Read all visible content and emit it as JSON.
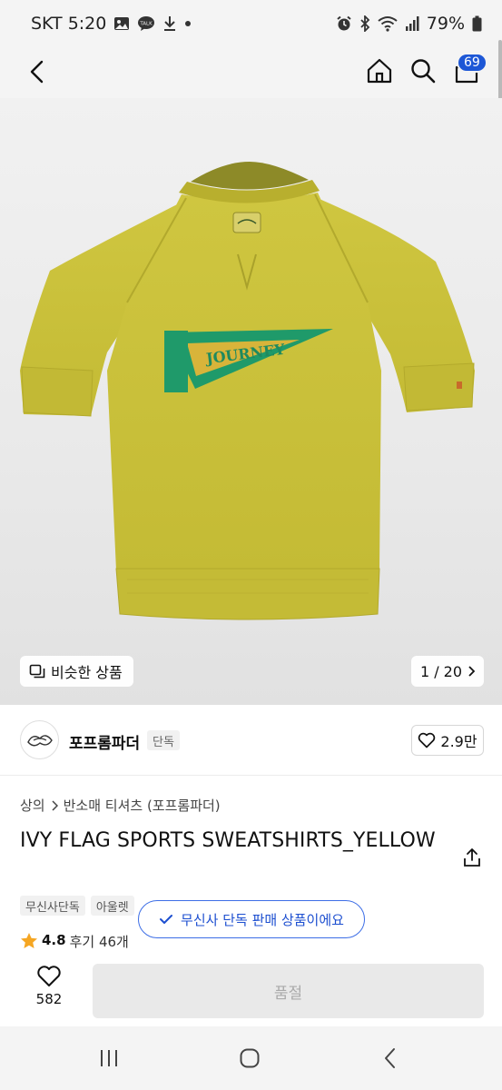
{
  "status_bar": {
    "carrier_time": "SKT 5:20",
    "battery": "79%",
    "left_icons": [
      "image-icon",
      "talk-icon",
      "download-icon",
      "dot-icon"
    ],
    "right_icons": [
      "alarm-icon",
      "bluetooth-icon",
      "wifi-icon",
      "signal-icon",
      "battery-icon"
    ]
  },
  "nav": {
    "cart_count": "69"
  },
  "gallery": {
    "similar_label": "비슷한 상품",
    "counter": "1 / 20",
    "print_text": "JOURNEY"
  },
  "brand": {
    "name": "포프롬파더",
    "tag": "단독",
    "likes": "2.9만"
  },
  "breadcrumb": {
    "category": "상의",
    "subcategory": "반소매 티셔츠 (포프롬파더)"
  },
  "product": {
    "title": "IVY FLAG SPORTS SWEATSHIRTS_YELLOW",
    "chips": [
      "무신사단독",
      "아울렛"
    ],
    "exclusive_notice": "무신사 단독 판매 상품이에요",
    "rating": "4.8",
    "review_label": "후기 46개"
  },
  "bottom": {
    "wish_count": "582",
    "soldout_label": "품절"
  },
  "colors": {
    "accent": "#1d57d6",
    "shirt": "#c9c13a",
    "pennant_green": "#1f9a6a",
    "pennant_yellow": "#d8b43a",
    "star": "#f5a623"
  }
}
